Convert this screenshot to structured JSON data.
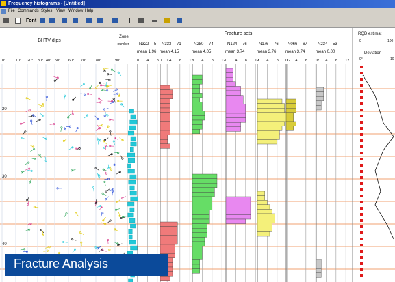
{
  "window": {
    "title": "Frequency histograms - [Untitled]"
  },
  "menu": [
    "File",
    "Commands",
    "Styles",
    "View",
    "Window",
    "Help"
  ],
  "toolbar": {
    "font_label": "Font"
  },
  "headers": {
    "bhtv": "BHTV dips",
    "zone": "Zone",
    "zone_sub": "number",
    "fracture_sets": "Fracture sets",
    "rqd": "RQD estimat",
    "rqd_min": "0",
    "rqd_max": "100",
    "deviation": "Deviation",
    "deviation_min": "0°",
    "deviation_max": "10"
  },
  "dip_ticks": [
    "0°",
    "10°",
    "20°",
    "30°",
    "40°",
    "50°",
    "60°",
    "70°",
    "80°",
    "90°"
  ],
  "depth_labels": [
    "20",
    "30",
    "40"
  ],
  "sets": [
    {
      "name": "N322",
      "count": "5",
      "mean": "mean 1.96",
      "scale": [
        "0",
        "4",
        "8",
        "12"
      ],
      "color": "#22c8d8"
    },
    {
      "name": "N333",
      "count": "71",
      "mean": "mean 4.15",
      "scale": [
        "0",
        "4",
        "8",
        "12"
      ],
      "color": "#f07a7a"
    },
    {
      "name": "N280",
      "count": "74",
      "mean": "mean 4.05",
      "scale": [
        "0",
        "4",
        "8",
        "12"
      ],
      "color": "#66dd66"
    },
    {
      "name": "N124",
      "count": "76",
      "mean": "mean 3.74",
      "scale": [
        "0",
        "4",
        "8",
        "12"
      ],
      "color": "#e888f0"
    },
    {
      "name": "N176",
      "count": "76",
      "mean": "mean 3.76",
      "scale": [
        "0",
        "4",
        "8",
        "12"
      ],
      "color": "#f4f07a"
    },
    {
      "name": "N066",
      "count": "67",
      "mean": "mean 3.74",
      "scale": [
        "0",
        "4",
        "8",
        "12"
      ],
      "color": "#d8cc3a"
    },
    {
      "name": "N234",
      "count": "53",
      "mean": "mean 0.00",
      "scale": [
        "0",
        "4",
        "8",
        "12"
      ],
      "color": "#c8c8c8"
    }
  ],
  "overlay": {
    "caption": "Fracture Analysis"
  }
}
